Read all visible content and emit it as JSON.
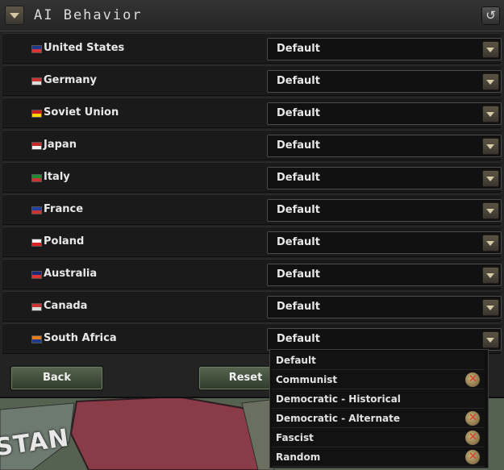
{
  "header": {
    "title": "AI Behavior",
    "collapse_icon": "chevron-down-icon",
    "reset_icon": "undo-icon"
  },
  "rows": [
    {
      "country": "United States",
      "value": "Default",
      "flag_colors": [
        "#1f3b8a",
        "#d33"
      ]
    },
    {
      "country": "Germany",
      "value": "Default",
      "flag_colors": [
        "#c33",
        "#ddd"
      ]
    },
    {
      "country": "Soviet Union",
      "value": "Default",
      "flag_colors": [
        "#cc1f1f",
        "#ffd400"
      ]
    },
    {
      "country": "Japan",
      "value": "Default",
      "flag_colors": [
        "#c62a2a",
        "#f4f4f4"
      ]
    },
    {
      "country": "Italy",
      "value": "Default",
      "flag_colors": [
        "#1f8a36",
        "#c33"
      ]
    },
    {
      "country": "France",
      "value": "Default",
      "flag_colors": [
        "#2341a0",
        "#c33"
      ]
    },
    {
      "country": "Poland",
      "value": "Default",
      "flag_colors": [
        "#f4f4f4",
        "#d22"
      ]
    },
    {
      "country": "Australia",
      "value": "Default",
      "flag_colors": [
        "#1a2c77",
        "#d33"
      ]
    },
    {
      "country": "Canada",
      "value": "Default",
      "flag_colors": [
        "#c33",
        "#ddd"
      ]
    },
    {
      "country": "South Africa",
      "value": "Default",
      "flag_colors": [
        "#e57d1e",
        "#1f3b8a"
      ]
    }
  ],
  "buttons": {
    "back": "Back",
    "reset": "Reset"
  },
  "dropdown": {
    "options": [
      {
        "label": "Default",
        "locked": false
      },
      {
        "label": "Communist",
        "locked": true
      },
      {
        "label": "Democratic - Historical",
        "locked": false
      },
      {
        "label": "Democratic - Alternate",
        "locked": true
      },
      {
        "label": "Fascist",
        "locked": true
      },
      {
        "label": "Random",
        "locked": true
      }
    ]
  },
  "map": {
    "label": "STAN"
  }
}
